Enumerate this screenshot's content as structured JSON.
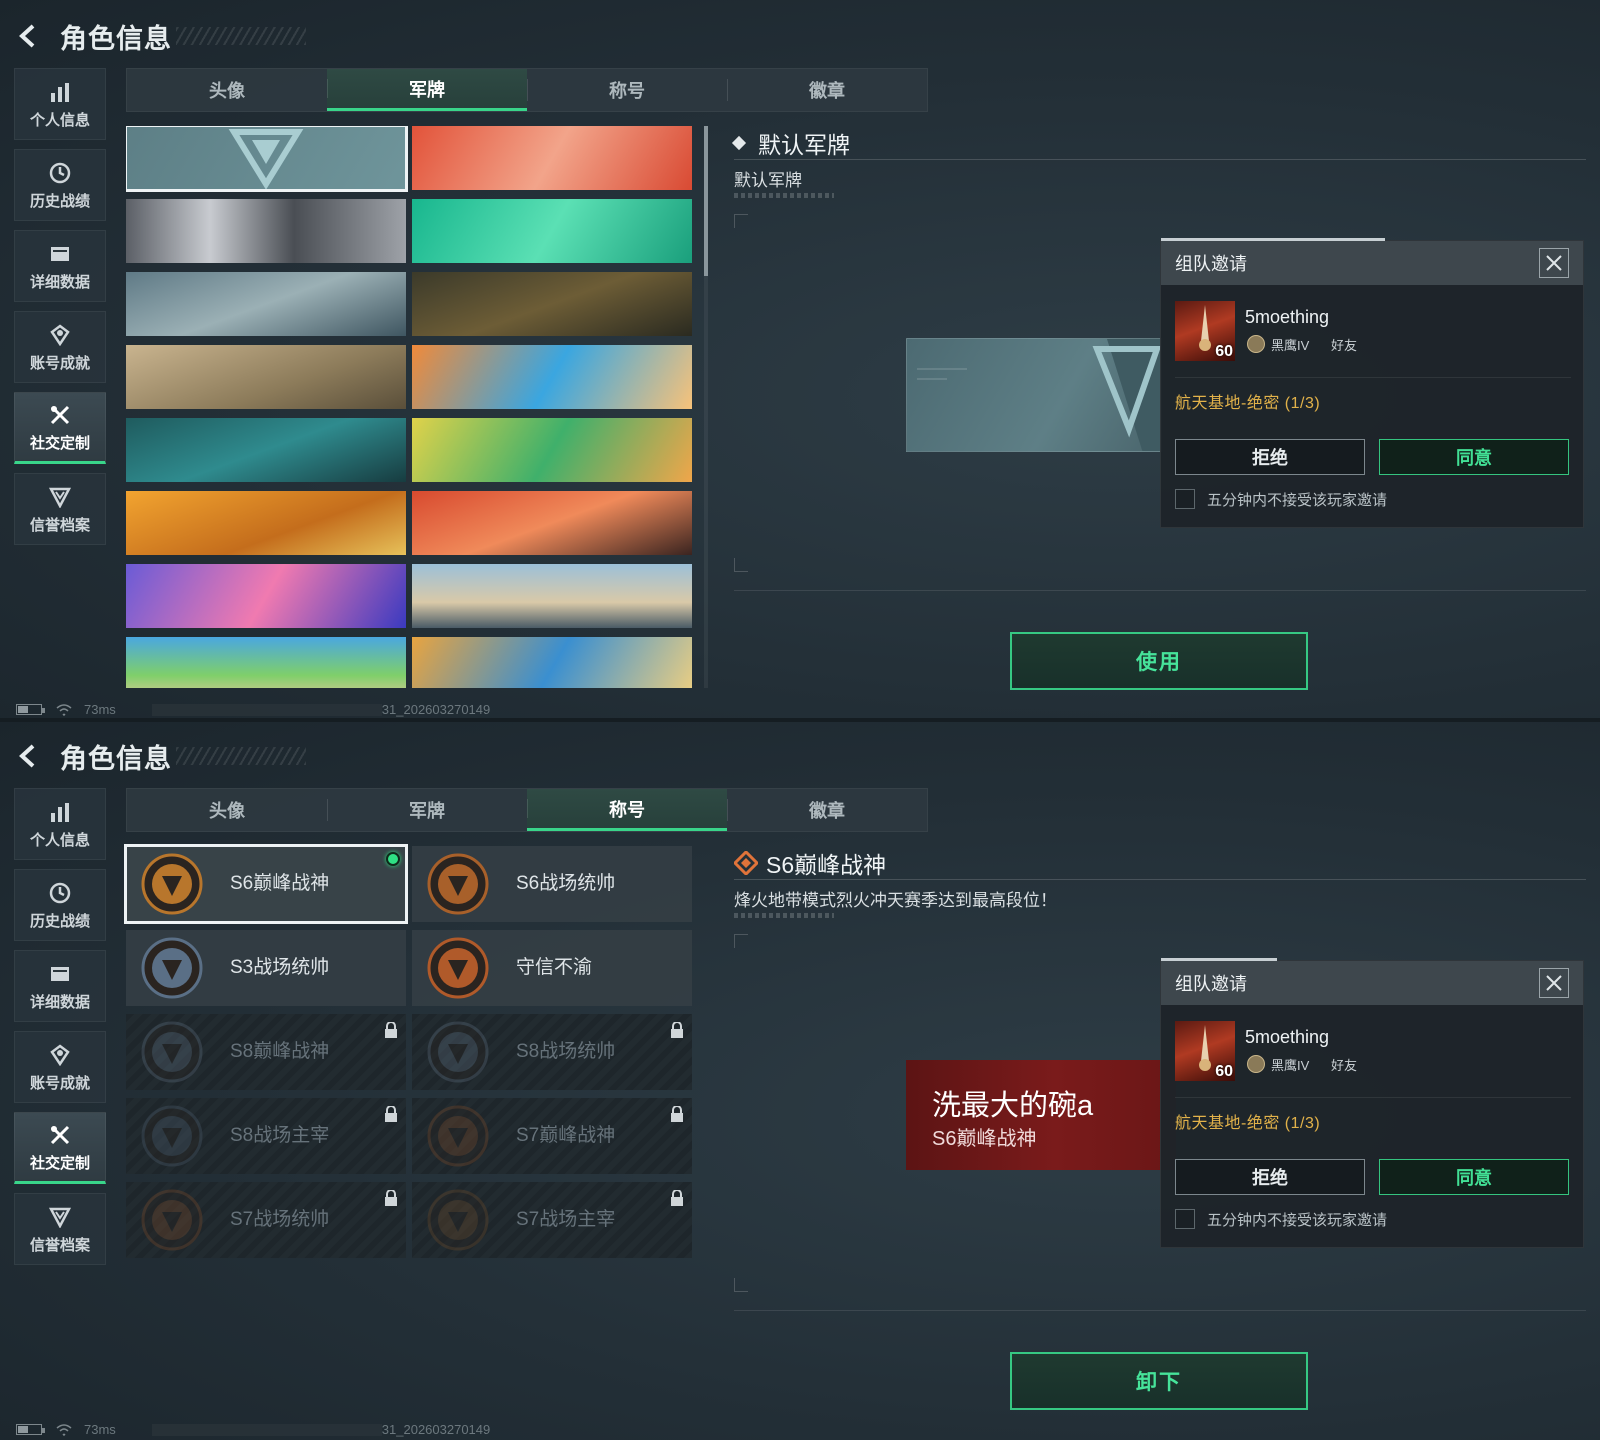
{
  "header": {
    "title": "角色信息"
  },
  "sidebar": {
    "items": [
      {
        "label": "个人信息",
        "icon": "bar-chart-icon"
      },
      {
        "label": "历史战绩",
        "icon": "clock-icon"
      },
      {
        "label": "详细数据",
        "icon": "folder-icon"
      },
      {
        "label": "账号成就",
        "icon": "medal-icon"
      },
      {
        "label": "社交定制",
        "icon": "tools-icon",
        "active": true
      },
      {
        "label": "信誉档案",
        "icon": "shield-icon"
      }
    ]
  },
  "tabs": [
    {
      "label": "头像"
    },
    {
      "label": "军牌"
    },
    {
      "label": "称号"
    },
    {
      "label": "徽章"
    }
  ],
  "top_screen": {
    "active_tab": "军牌",
    "detail": {
      "title": "默认军牌",
      "description": "默认军牌"
    },
    "action_button": "使用",
    "selected_plate": 0,
    "plates_count": 16
  },
  "bottom_screen": {
    "active_tab": "称号",
    "titles": [
      {
        "name": "S6巅峰战神",
        "selected": true,
        "equipped": true,
        "locked": false
      },
      {
        "name": "S6战场统帅",
        "locked": false
      },
      {
        "name": "S3战场统帅",
        "locked": false
      },
      {
        "name": "守信不渝",
        "locked": false
      },
      {
        "name": "S8巅峰战神",
        "locked": true
      },
      {
        "name": "S8战场统帅",
        "locked": true
      },
      {
        "name": "S8战场主宰",
        "locked": true
      },
      {
        "name": "S7巅峰战神",
        "locked": true
      },
      {
        "name": "S7战场统帅",
        "locked": true
      },
      {
        "name": "S7战场主宰",
        "locked": true
      }
    ],
    "detail": {
      "title": "S6巅峰战神",
      "description": "烽火地带模式烈火冲天赛季达到最高段位！"
    },
    "preview": {
      "player_name": "洗最大的碗a",
      "title": "S6巅峰战神"
    },
    "action_button": "卸下"
  },
  "invite": {
    "header": "组队邀请",
    "player_name": "5moething",
    "level": "60",
    "rank": "黑鹰IV",
    "relation": "好友",
    "mode": "航天基地-绝密 (1/3)",
    "reject_label": "拒绝",
    "accept_label": "同意",
    "checkbox_label": "五分钟内不接受该玩家邀请"
  },
  "status": {
    "ping": "73ms",
    "build": "31_202603270149"
  },
  "colors": {
    "accent_green": "#39d58a",
    "mode_gold": "#e2b24a",
    "title_red": "#7a1b1b"
  }
}
